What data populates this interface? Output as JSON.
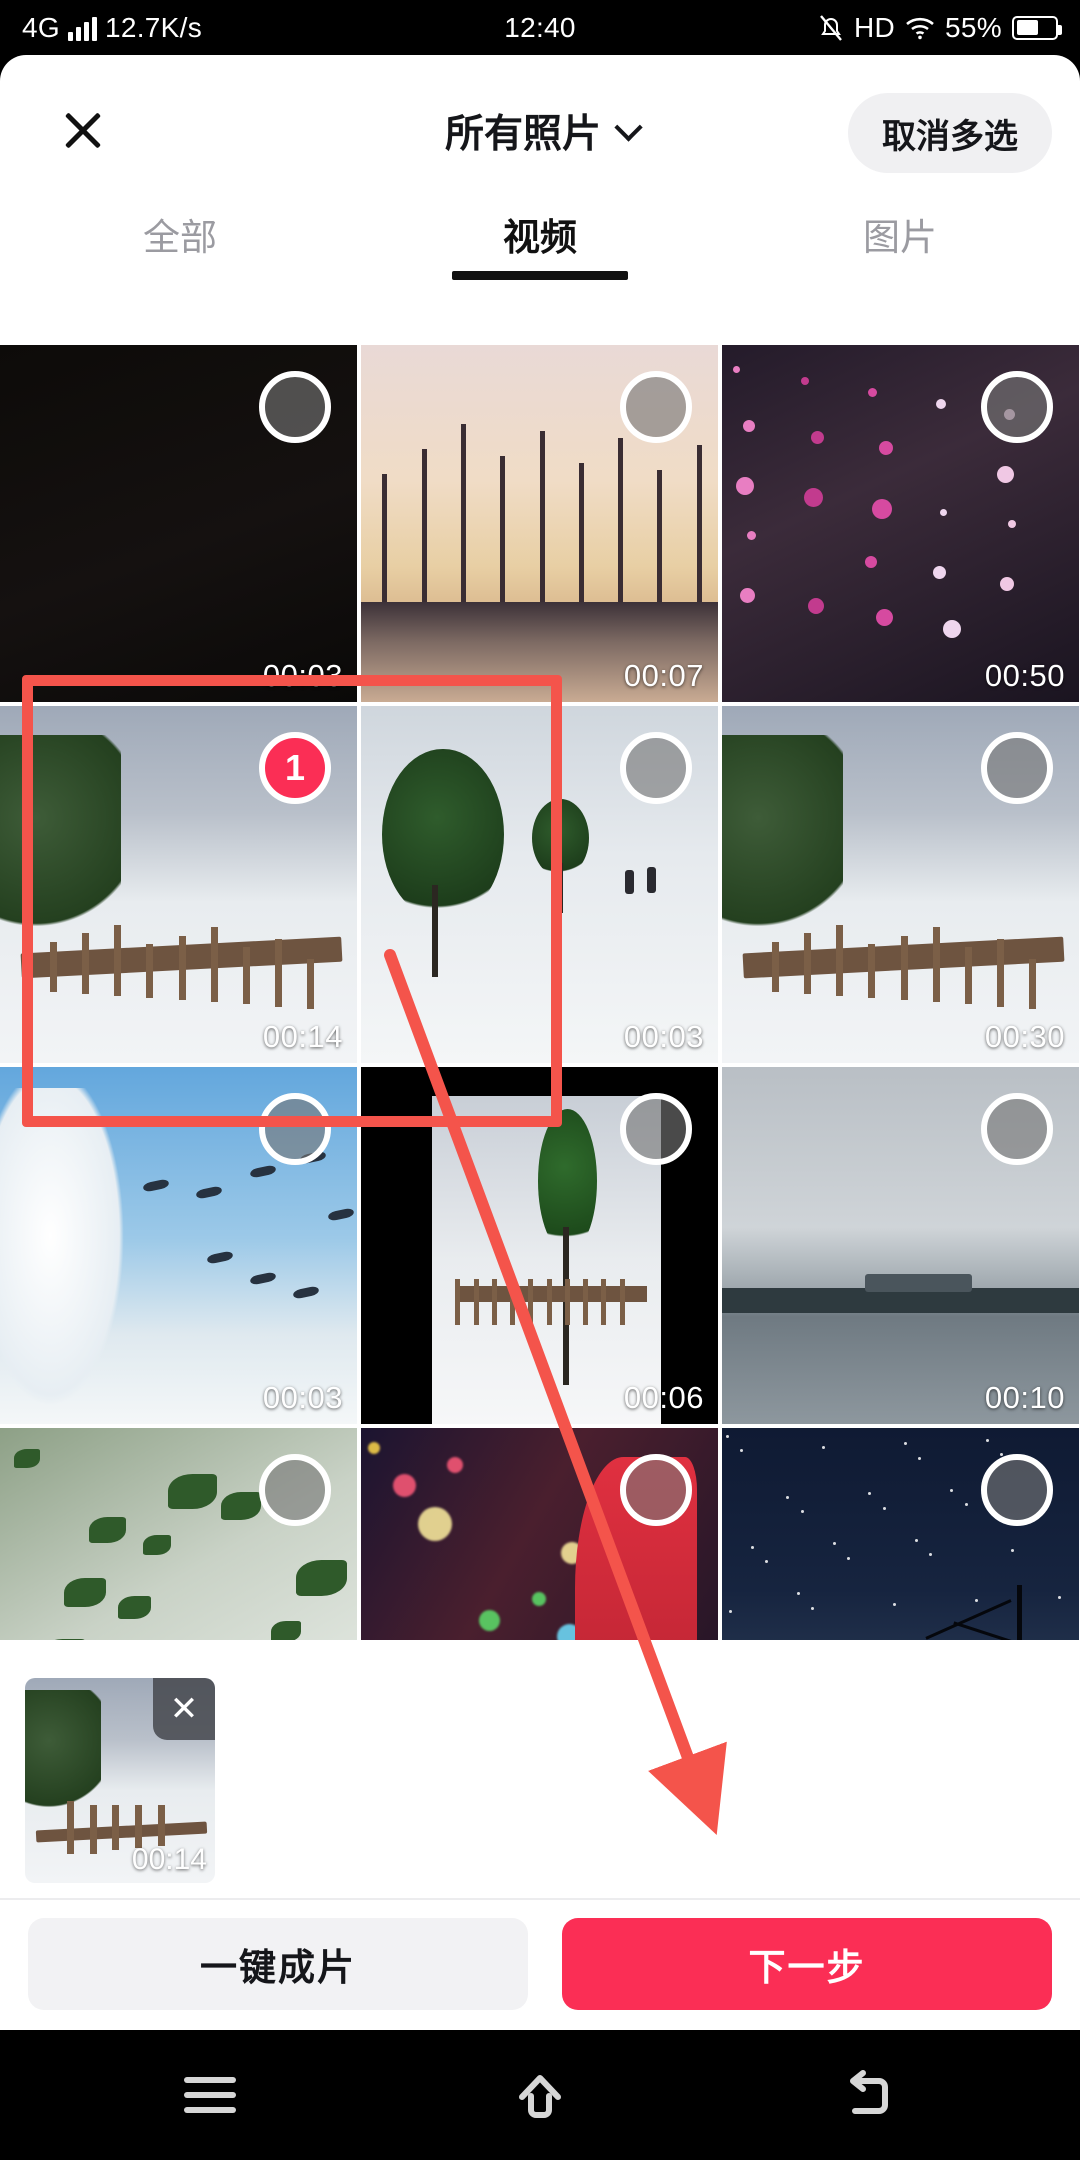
{
  "status_bar": {
    "network": "4G",
    "speed": "12.7K/s",
    "time": "12:40",
    "hd": "HD",
    "battery_percent": "55%",
    "icons": [
      "signal-bars-icon",
      "mute-icon",
      "hd-icon",
      "wifi-icon",
      "battery-icon"
    ]
  },
  "header": {
    "close_icon": "close-icon",
    "album_title": "所有照片",
    "album_chevron": "chevron-down-icon",
    "cancel_multiselect_label": "取消多选"
  },
  "tabs": [
    {
      "label": "全部",
      "active": false
    },
    {
      "label": "视频",
      "active": true
    },
    {
      "label": "图片",
      "active": false
    }
  ],
  "grid": {
    "items": [
      {
        "duration": "00:03",
        "selected": false,
        "badge": "",
        "scene": "dark"
      },
      {
        "duration": "00:07",
        "selected": false,
        "badge": "",
        "scene": "sunset"
      },
      {
        "duration": "00:50",
        "selected": false,
        "badge": "",
        "scene": "blossom"
      },
      {
        "duration": "00:14",
        "selected": true,
        "badge": "1",
        "scene": "snowfence"
      },
      {
        "duration": "00:03",
        "selected": false,
        "badge": "",
        "scene": "snowhill"
      },
      {
        "duration": "00:30",
        "selected": false,
        "badge": "",
        "scene": "snowfence"
      },
      {
        "duration": "00:03",
        "selected": false,
        "badge": "",
        "scene": "birds"
      },
      {
        "duration": "00:06",
        "selected": false,
        "badge": "",
        "scene": "yard"
      },
      {
        "duration": "00:10",
        "selected": false,
        "badge": "",
        "scene": "lake"
      },
      {
        "duration": "",
        "selected": false,
        "badge": "",
        "scene": "green"
      },
      {
        "duration": "",
        "selected": false,
        "badge": "",
        "scene": "fest"
      },
      {
        "duration": "",
        "selected": false,
        "badge": "",
        "scene": "night"
      }
    ]
  },
  "selected_tray": {
    "items": [
      {
        "duration": "00:14",
        "remove_label": "✕",
        "scene": "snowfence"
      }
    ]
  },
  "actions": {
    "auto_compose_label": "一键成片",
    "next_label": "下一步"
  },
  "nav_bar": {
    "recents_icon": "menu-icon",
    "home_icon": "home-icon",
    "back_icon": "back-icon"
  },
  "annotations": {
    "highlight_box": "red-rectangle-annotation",
    "pointer": "red-arrow-annotation"
  },
  "colors": {
    "accent_red": "#fb2e55",
    "annotation_red": "#f4544b",
    "chip_gray": "#f0f0f2",
    "tab_inactive": "#9b9ba1"
  }
}
